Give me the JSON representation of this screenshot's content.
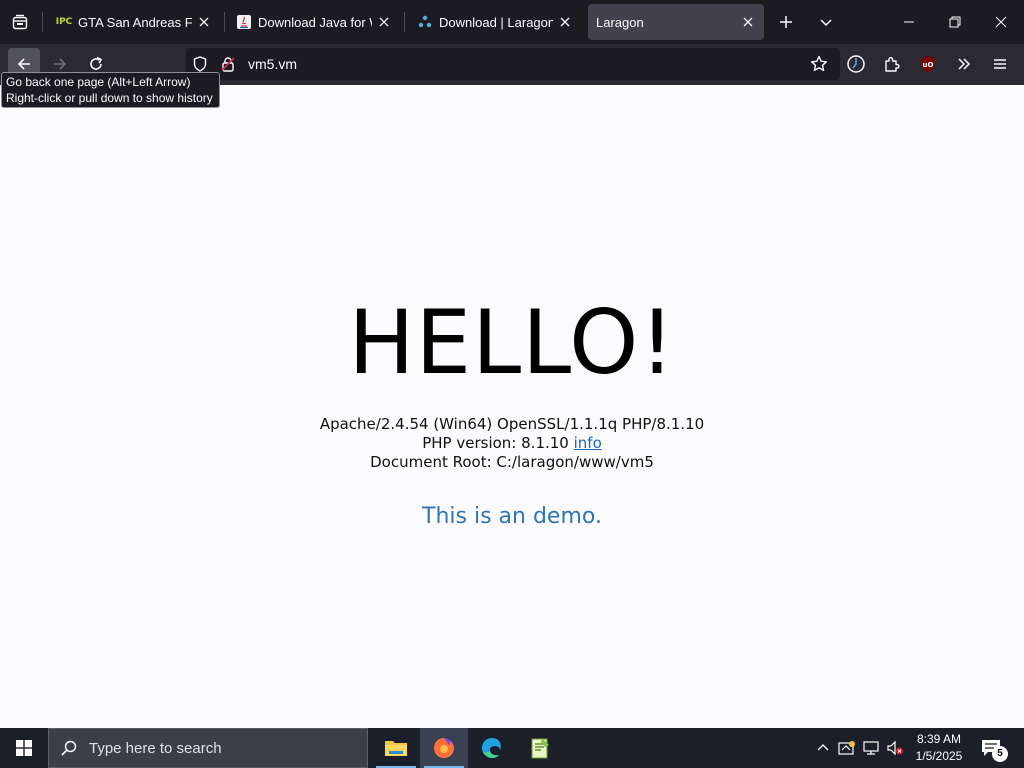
{
  "browser": {
    "tabs": [
      {
        "title": "GTA San Andreas Free |",
        "favicon_text": "IPC",
        "active": false
      },
      {
        "title": "Download Java for Win",
        "active": false
      },
      {
        "title": "Download | Laragon - |",
        "active": false
      },
      {
        "title": "Laragon",
        "active": true
      }
    ],
    "url": "vm5.vm",
    "back_tooltip": {
      "line1": "Go back one page (Alt+Left Arrow)",
      "line2": "Right-click or pull down to show history"
    },
    "extension_badge": "uO"
  },
  "page": {
    "heading": "HELLO!",
    "server_line": "Apache/2.4.54 (Win64) OpenSSL/1.1.1q PHP/8.1.10",
    "php_version_label": "PHP version: 8.1.10 ",
    "php_info_link": "info",
    "document_root": "Document Root: C:/laragon/www/vm5",
    "demo_text": "This is an demo."
  },
  "taskbar": {
    "search_placeholder": "Type here to search",
    "time": "8:39 AM",
    "date": "1/5/2025",
    "notification_count": "5"
  },
  "colors": {
    "tabstrip_bg": "#1c1b22",
    "navbar_bg": "#2b2a33",
    "link": "#1a66b5",
    "demo_text": "#2f74b5",
    "taskbar_bg": "#1b1f2a"
  }
}
